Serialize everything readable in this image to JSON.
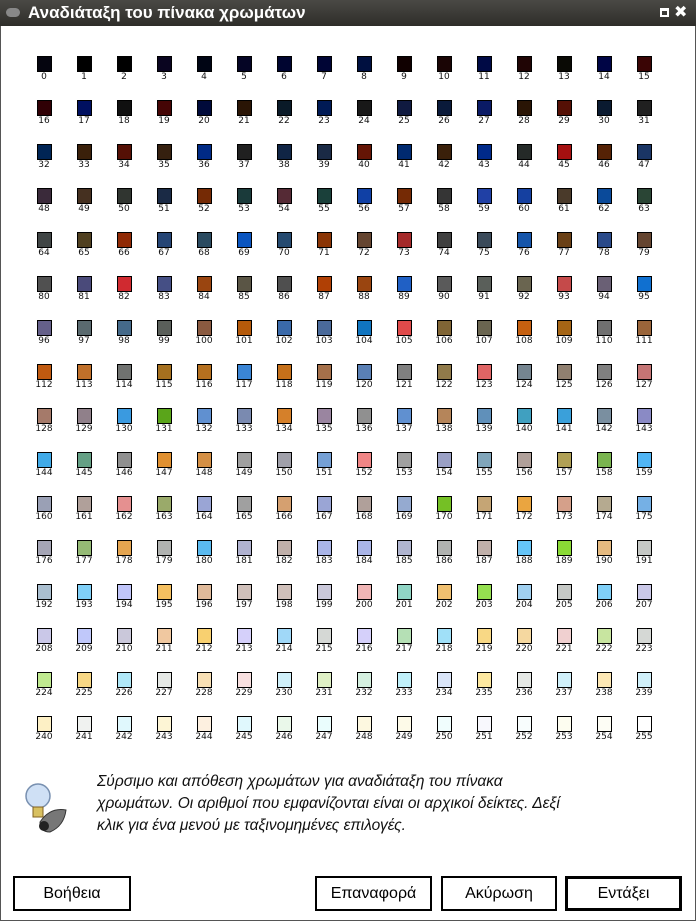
{
  "window": {
    "title": "Αναδιάταξη του πίνακα χρωμάτων"
  },
  "colors": [
    "#05050f",
    "#000000",
    "#000000",
    "#0a0520",
    "#000514",
    "#050525",
    "#000530",
    "#000535",
    "#001040",
    "#100000",
    "#1a0505",
    "#000a45",
    "#200505",
    "#0a0a05",
    "#000545",
    "#3a0505",
    "#300005",
    "#001060",
    "#101010",
    "#450505",
    "#000a3a",
    "#2a1505",
    "#0a1a28",
    "#001a55",
    "#181818",
    "#101a40",
    "#0a1a3a",
    "#0a1a65",
    "#2a1505",
    "#551005",
    "#0a1a30",
    "#202020",
    "#002555",
    "#3a200a",
    "#551005",
    "#35200f",
    "#002a85",
    "#202020",
    "#102545",
    "#1a2a45",
    "#651505",
    "#002a70",
    "#3a200a",
    "#002a8a",
    "#252a28",
    "#a51010",
    "#552205",
    "#1a3565",
    "#3a2a3a",
    "#453020",
    "#303530",
    "#1a2a45",
    "#752a05",
    "#1a3a3a",
    "#552a35",
    "#1a403a",
    "#1040a5",
    "#752a05",
    "#353535",
    "#2040a5",
    "#1540a0",
    "#4a3a2a",
    "#0a4a9a",
    "#2a4535",
    "#404545",
    "#504020",
    "#902a05",
    "#254575",
    "#2a4a60",
    "#0a55c0",
    "#254a70",
    "#8a3505",
    "#654530",
    "#a52a2a",
    "#404040",
    "#3a4a5a",
    "#1555aa",
    "#6a4015",
    "#2a4a8a",
    "#654530",
    "#505050",
    "#4a4a7a",
    "#d02a30",
    "#454f85",
    "#9a4510",
    "#5a5545",
    "#4f4f4f",
    "#b04005",
    "#9a4510",
    "#2060c5",
    "#5a5a5a",
    "#5a5f5a",
    "#6a6550",
    "#c54a4a",
    "#6a6075",
    "#1070d0",
    "#65608a",
    "#5a6a6f",
    "#456a8a",
    "#5a5f5a",
    "#8a5a40",
    "#b55a0a",
    "#3a6aaa",
    "#4a6a9a",
    "#1075c0",
    "#e04a4a",
    "#806535",
    "#6a6550",
    "#c56010",
    "#a56515",
    "#707070",
    "#9a653a",
    "#c05a10",
    "#c0702a",
    "#707270",
    "#a5701f",
    "#b5701f",
    "#3a85d5",
    "#c5701a",
    "#a5704a",
    "#5a80b5",
    "#808080",
    "#907a4a",
    "#e06565",
    "#758590",
    "#908070",
    "#808080",
    "#c57575",
    "#a57a6a",
    "#90808a",
    "#3a9ae0",
    "#5aa51a",
    "#6090d0",
    "#7a8ab0",
    "#d5802a",
    "#9a85a0",
    "#909090",
    "#6090d0",
    "#b5855a",
    "#6090ba",
    "#40a0c0",
    "#3aa0da",
    "#7a8fa0",
    "#8a8ac5",
    "#40aae8",
    "#65a085",
    "#909090",
    "#e09030",
    "#d59045",
    "#a0a0a0",
    "#a0a0aa",
    "#75a0d5",
    "#f08585",
    "#a0a0a0",
    "#9aa0c5",
    "#80a5ba",
    "#b0a09a",
    "#b0a055",
    "#7ab550",
    "#50b5f5",
    "#9aa0b5",
    "#b0a09a",
    "#e59090",
    "#9aaa6a",
    "#9aa5d5",
    "#a0a0a0",
    "#d5a070",
    "#9aa5d5",
    "#b0a09a",
    "#95aad0",
    "#75c025",
    "#c5a575",
    "#eaa540",
    "#d5a08a",
    "#b5aa90",
    "#75b0e5",
    "#a5a5b5",
    "#95ba75",
    "#e5a550",
    "#b0b2b0",
    "#5abaf0",
    "#b0b2d0",
    "#c0b0aa",
    "#aab5e8",
    "#aab5e8",
    "#b0b5d0",
    "#b0b2b0",
    "#c0b0aa",
    "#65c5f8",
    "#8ada35",
    "#e5ba80",
    "#c5c8c5",
    "#aabfd0",
    "#80d0f8",
    "#c0c5fa",
    "#f5c060",
    "#e0ba9a",
    "#d0c0ba",
    "#d0c0ba",
    "#cac8da",
    "#f0b5b5",
    "#90d5c5",
    "#f0c070",
    "#95e050",
    "#a0d0f0",
    "#c5c8c5",
    "#80d0f8",
    "#cac8e8",
    "#cac8e8",
    "#c0c8fa",
    "#cac8da",
    "#f0c8a0",
    "#f8d070",
    "#d5d0fa",
    "#a0d8f8",
    "#d5d8d5",
    "#d5d0fa",
    "#b5e0b5",
    "#a0e0f8",
    "#f8d885",
    "#f5d8a0",
    "#f0d0d0",
    "#c8e5a0",
    "#d5d8d5",
    "#c0ea90",
    "#f8d885",
    "#b0e8f8",
    "#e5e8e5",
    "#f8e0b5",
    "#f8e0e0",
    "#d0f0fa",
    "#dff0c5",
    "#d5f0e0",
    "#c0f0fa",
    "#dae5f8",
    "#fde8a0",
    "#e5e8e5",
    "#d0f0fa",
    "#fde8b5",
    "#d0f0fa",
    "#fdf0c5",
    "#f0f2f0",
    "#e0f8fd",
    "#fdf5d5",
    "#fdf0e0",
    "#e0f8fd",
    "#eaf8ea",
    "#eafdfd",
    "#fdf8e0",
    "#fdfae8",
    "#f0fdfd",
    "#f8f8fd",
    "#f8fdfd",
    "#fdfdf0",
    "#fdfdf5",
    "#ffffff"
  ],
  "hint": {
    "icon": "gimp-lightbulb-icon",
    "text": "Σύρσιμο και απόθεση χρωμάτων για αναδιάταξη του πίνακα χρωμάτων. Οι αριθμοί που εμφανίζονται είναι οι αρχικοί δείκτες. Δεξί κλικ για ένα μενού με ταξινομημένες επιλογές."
  },
  "buttons": {
    "help": "Βοήθεια",
    "reset": "Επαναφορά",
    "cancel": "Ακύρωση",
    "ok": "Εντάξει"
  }
}
